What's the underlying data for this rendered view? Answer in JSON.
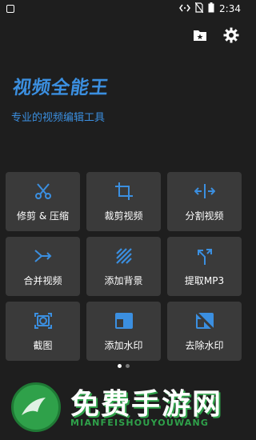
{
  "status_bar": {
    "time": "2:34",
    "icons": [
      "code-icon",
      "no-sim-icon",
      "battery-icon"
    ]
  },
  "toolbar": {
    "icons": [
      "folder-star-icon",
      "gear-icon"
    ]
  },
  "app": {
    "title": "视频全能王",
    "subtitle": "专业的视频编辑工具",
    "accent_color": "#3b8fe0"
  },
  "tools": [
    {
      "label": "修剪 & 压缩",
      "icon": "scissors-icon"
    },
    {
      "label": "裁剪视频",
      "icon": "crop-icon"
    },
    {
      "label": "分割视频",
      "icon": "split-icon"
    },
    {
      "label": "合并视频",
      "icon": "merge-icon"
    },
    {
      "label": "添加背景",
      "icon": "background-stripes-icon"
    },
    {
      "label": "提取MP3",
      "icon": "extract-icon"
    },
    {
      "label": "截图",
      "icon": "screenshot-camera-icon"
    },
    {
      "label": "添加水印",
      "icon": "add-watermark-icon"
    },
    {
      "label": "去除水印",
      "icon": "remove-watermark-icon"
    }
  ],
  "pager": {
    "pages": 2,
    "current": 1
  },
  "watermark": {
    "text": "免费手游网",
    "subtext": "MIANFEISHOUYOUWANG"
  }
}
